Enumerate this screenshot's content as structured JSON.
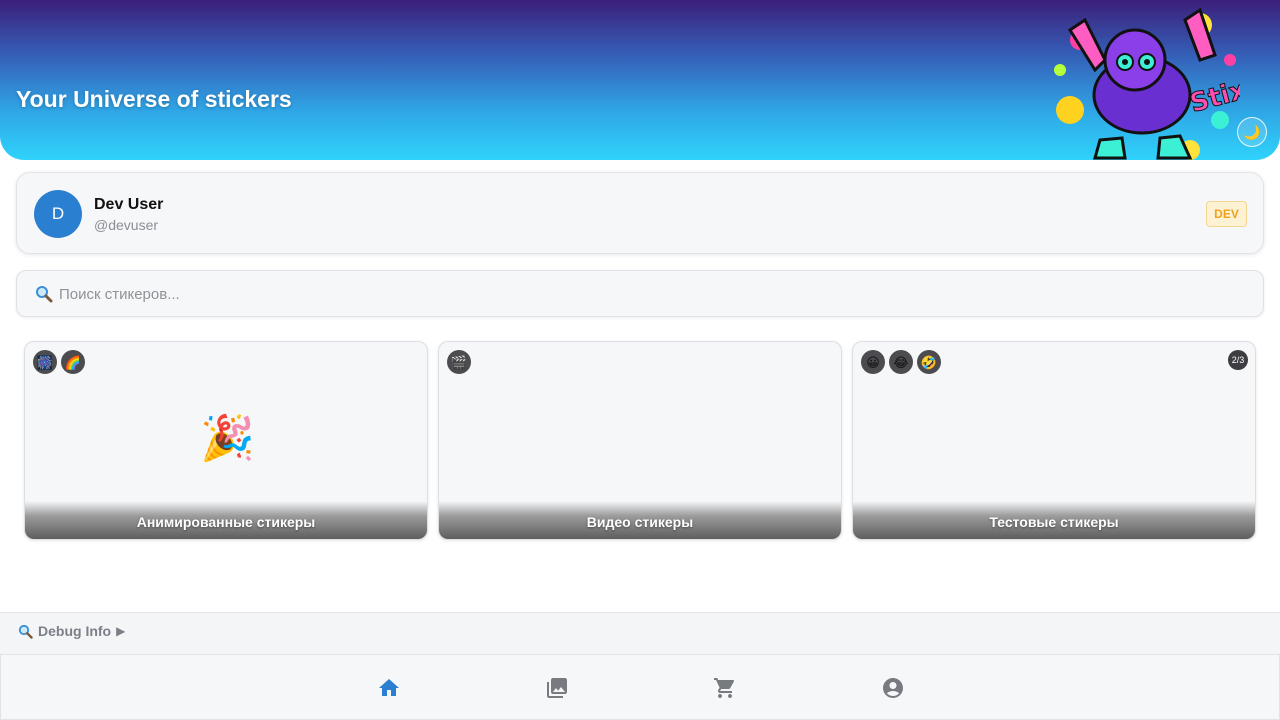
{
  "header": {
    "title": "Your Universe of stickers",
    "theme_toggle_icon": "🌙",
    "mascot_icon": "sticker-mascot-icon",
    "gradient": [
      "#3b1f7a",
      "#2fd3fb"
    ]
  },
  "user": {
    "avatar_letter": "D",
    "name": "Dev User",
    "handle": "@devuser",
    "badge": "DEV",
    "avatar_color": "#2b7fd0"
  },
  "search": {
    "placeholder": "Поиск стикеров...",
    "value": ""
  },
  "packs": [
    {
      "title": "Анимированные стикеры",
      "icons": [
        "🎆",
        "🌈"
      ],
      "preview": "🎉",
      "page_indicator": ""
    },
    {
      "title": "Видео стикеры",
      "icons": [
        "🎬"
      ],
      "preview": "",
      "page_indicator": ""
    },
    {
      "title": "Тестовые стикеры",
      "icons": [
        "😀",
        "😂",
        "🤣"
      ],
      "preview": "",
      "page_indicator": "2/3"
    }
  ],
  "debug": {
    "label": "Debug Info",
    "arrow": "▶"
  },
  "nav": {
    "items": [
      {
        "name": "home",
        "icon": "home-icon",
        "active": true
      },
      {
        "name": "gallery",
        "icon": "gallery-icon",
        "active": false
      },
      {
        "name": "cart",
        "icon": "cart-icon",
        "active": false
      },
      {
        "name": "profile",
        "icon": "profile-icon",
        "active": false
      }
    ],
    "active_color": "#2b7fd0",
    "inactive_color": "#777b80"
  }
}
